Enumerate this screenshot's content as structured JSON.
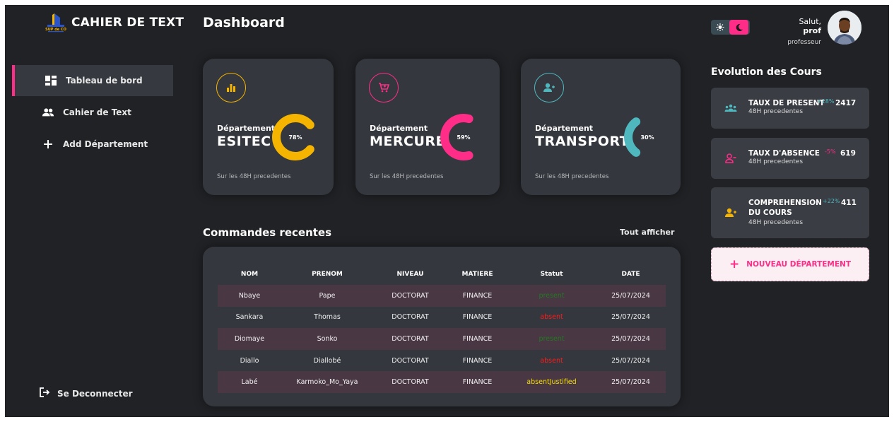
{
  "app": {
    "title": "CAHIER DE TEXT",
    "logo_text": "SUP de CO"
  },
  "sidebar": {
    "items": [
      {
        "label": "Tableau de bord",
        "icon": "dashboard-icon",
        "active": true
      },
      {
        "label": "Cahier de Text",
        "icon": "users-icon",
        "active": false
      },
      {
        "label": "Add Département",
        "icon": "plus-icon",
        "active": false
      }
    ],
    "logout_label": "Se Deconnecter"
  },
  "header": {
    "page_title": "Dashboard",
    "greeting": "Salut,",
    "user_name": "prof",
    "user_role": "professeur"
  },
  "departments": [
    {
      "label": "Département",
      "name": "ESITEC",
      "percent": 78,
      "percent_label": "78%",
      "subtitle": "Sur les 48H precedentes",
      "color": "#f5b400",
      "icon": "bar-chart-icon"
    },
    {
      "label": "Département",
      "name": "MERCURE",
      "percent": 59,
      "percent_label": "59%",
      "subtitle": "Sur les 48H precedentes",
      "color": "#ff2d87",
      "icon": "cart-icon"
    },
    {
      "label": "Département",
      "name": "TRANSPORT",
      "percent": 30,
      "percent_label": "30%",
      "subtitle": "Sur les 48H precedentes",
      "color": "#4fb8bf",
      "icon": "user-plus-icon"
    }
  ],
  "orders": {
    "title": "Commandes recentes",
    "show_all": "Tout afficher",
    "columns": [
      "NOM",
      "PRENOM",
      "NIVEAU",
      "MATIERE",
      "Statut",
      "DATE"
    ],
    "rows": [
      [
        "Nbaye",
        "Pape",
        "DOCTORAT",
        "FINANCE",
        "present",
        "25/07/2024"
      ],
      [
        "Sankara",
        "Thomas",
        "DOCTORAT",
        "FINANCE",
        "absent",
        "25/07/2024"
      ],
      [
        "Diomaye",
        "Sonko",
        "DOCTORAT",
        "FINANCE",
        "present",
        "25/07/2024"
      ],
      [
        "Diallo",
        "Diallobé",
        "DOCTORAT",
        "FINANCE",
        "absent",
        "25/07/2024"
      ],
      [
        "Labé",
        "Karmoko_Mo_Yaya",
        "DOCTORAT",
        "FINANCE",
        "absentJustified",
        "25/07/2024"
      ]
    ]
  },
  "evolution": {
    "title": "Evolution des Cours",
    "stats": [
      {
        "title": "TAUX DE PRESENT",
        "subtitle": "48H precedentes",
        "change": "+18%",
        "value": "2417",
        "change_color": "#4fb8bf",
        "icon": "group-icon",
        "icon_color": "#4fb8bf"
      },
      {
        "title": "TAUX D'ABSENCE",
        "subtitle": "48H precedentes",
        "change": "-5%",
        "value": "619",
        "change_color": "#ff2d87",
        "icon": "user-minus-icon",
        "icon_color": "#ff2d87"
      },
      {
        "title": "COMPREHENSION",
        "title2": "DU COURS",
        "subtitle": "48H precedentes",
        "change": "+22%",
        "value": "411",
        "change_color": "#4fb8bf",
        "icon": "user-plus-icon",
        "icon_color": "#f5b400"
      }
    ],
    "new_department_label": "NOUVEAU DÉPARTEMENT"
  },
  "colors": {
    "accent": "#ff2d87",
    "background": "#202225",
    "card": "#34373d"
  }
}
